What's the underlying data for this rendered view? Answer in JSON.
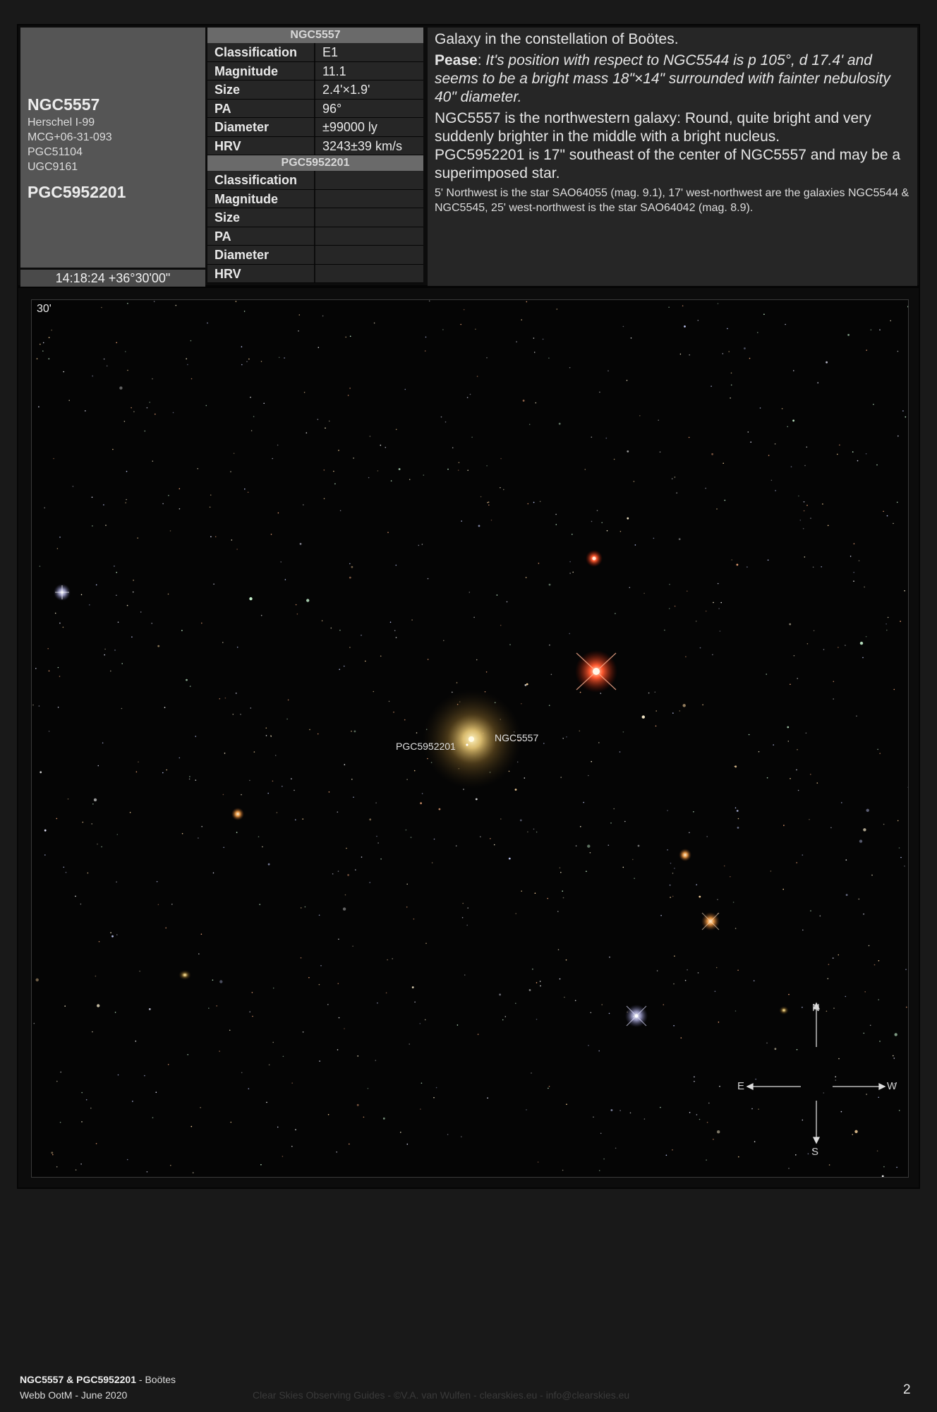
{
  "object": {
    "main_name": "NGC5557",
    "aliases": [
      "Herschel I-99",
      "MCG+06-31-093",
      "PGC51104",
      "UGC9161"
    ],
    "second_name": "PGC5952201",
    "coords": "14:18:24 +36°30'00\""
  },
  "table1": {
    "title": "NGC5557",
    "rows": [
      {
        "label": "Classification",
        "value": "E1"
      },
      {
        "label": "Magnitude",
        "value": "11.1"
      },
      {
        "label": "Size",
        "value": "2.4'×1.9'"
      },
      {
        "label": "PA",
        "value": "96°"
      },
      {
        "label": "Diameter",
        "value": "±99000 ly"
      },
      {
        "label": "HRV",
        "value": "3243±39 km/s"
      }
    ]
  },
  "table2": {
    "title": "PGC5952201",
    "rows": [
      {
        "label": "Classification",
        "value": ""
      },
      {
        "label": "Magnitude",
        "value": ""
      },
      {
        "label": "Size",
        "value": ""
      },
      {
        "label": "PA",
        "value": ""
      },
      {
        "label": "Diameter",
        "value": ""
      },
      {
        "label": "HRV",
        "value": ""
      }
    ]
  },
  "description": {
    "line1": "Galaxy in the constellation of Boötes.",
    "pease_label": "Pease",
    "pease_sep": ": ",
    "pease_text": "It's position with respect to NGC5544 is p 105°, d 17.4' and seems to be a bright mass 18\"×14\" surrounded with fainter nebulosity 40\" diameter.",
    "para2": "NGC5557 is the northwestern galaxy: Round, quite bright and very suddenly brighter in the middle with a bright nucleus.",
    "para3": "PGC5952201 is 17\" southeast of the center of NGC5557 and may be a superimposed star.",
    "para4": "5' Northwest is the star SAO64055 (mag. 9.1), 17' west-northwest are the galaxies NGC5544 & NGC5545, 25' west-northwest is the star SAO64042 (mag. 8.9)."
  },
  "image": {
    "fov": "30'",
    "label_ngc": "NGC5557",
    "label_pgc": "PGC5952201",
    "compass": {
      "n": "N",
      "s": "S",
      "e": "E",
      "w": "W"
    }
  },
  "footer": {
    "title_bold": "NGC5557 & PGC5952201",
    "title_rest": " - Boötes",
    "subtitle": "Webb OotM - June 2020",
    "credit": "Clear Skies Observing Guides - ©V.A. van Wulfen - clearskies.eu - info@clearskies.eu",
    "page": "2"
  },
  "colors": {
    "background": "#191919",
    "panel": "#555555",
    "table_cell": "#262626",
    "table_title": "#6a6a6a",
    "sky": "#050505"
  }
}
